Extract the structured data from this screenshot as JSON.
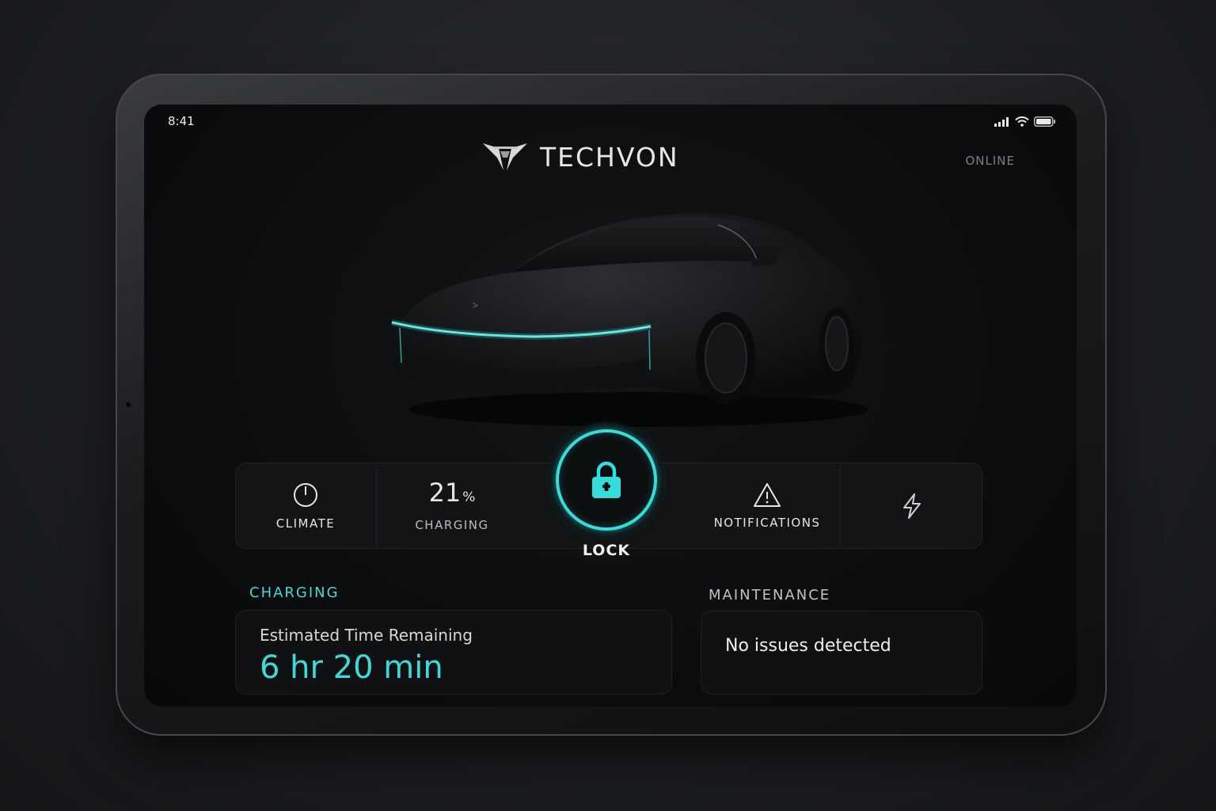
{
  "status_bar": {
    "time": "8:41"
  },
  "header": {
    "brand": "TECHVON",
    "connection_status": "ONLINE"
  },
  "controls": {
    "climate_label": "CLIMATE",
    "charge_percent": "21",
    "charge_percent_unit": "%",
    "charging_label": "CHARGING",
    "lock_label": "LOCK",
    "notifications_label": "NOTIFICATIONS",
    "power_icon": "lightning-bolt-icon"
  },
  "charging_section": {
    "title": "CHARGING",
    "eta_label": "Estimated Time Remaining",
    "eta_value": "6 hr 20 min"
  },
  "maintenance_section": {
    "title": "MAINTENANCE",
    "status": "No issues detected"
  },
  "colors": {
    "accent": "#3fd9d9",
    "background": "#0b0c0d",
    "text": "#e6e6e6"
  }
}
